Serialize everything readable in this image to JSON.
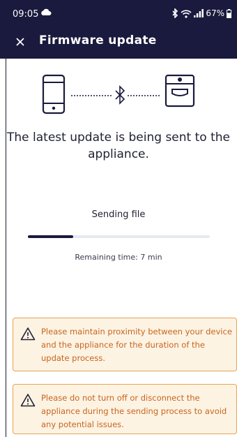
{
  "status_bar": {
    "time": "09:05",
    "battery": "67%",
    "icons": [
      "cloud-icon",
      "bluetooth-icon",
      "wifi-icon",
      "signal-icon",
      "battery-icon"
    ]
  },
  "header": {
    "title": "Firmware update",
    "close_icon": "close-icon"
  },
  "graphic": {
    "left_icon": "phone-icon",
    "middle_icon": "bluetooth-icon",
    "right_icon": "appliance-icon"
  },
  "message": "The latest update is being sent to the appliance.",
  "progress": {
    "label": "Sending file",
    "value": 0.25,
    "remaining": "Remaining time: 7 min"
  },
  "warnings": [
    {
      "icon": "warning-icon",
      "text": "Please maintain proximity between your device and the appliance for the duration of the update process."
    },
    {
      "icon": "warning-icon",
      "text": "Please do not turn off or disconnect the appliance during the sending process to avoid any potential issues."
    }
  ],
  "colors": {
    "header_bg": "#191a3d",
    "warning_bg": "#fdf3e3",
    "warning_border": "#e9a24f",
    "warning_text": "#c7651e",
    "progress_fill": "#191a3d",
    "progress_track": "#e4eaf1"
  }
}
